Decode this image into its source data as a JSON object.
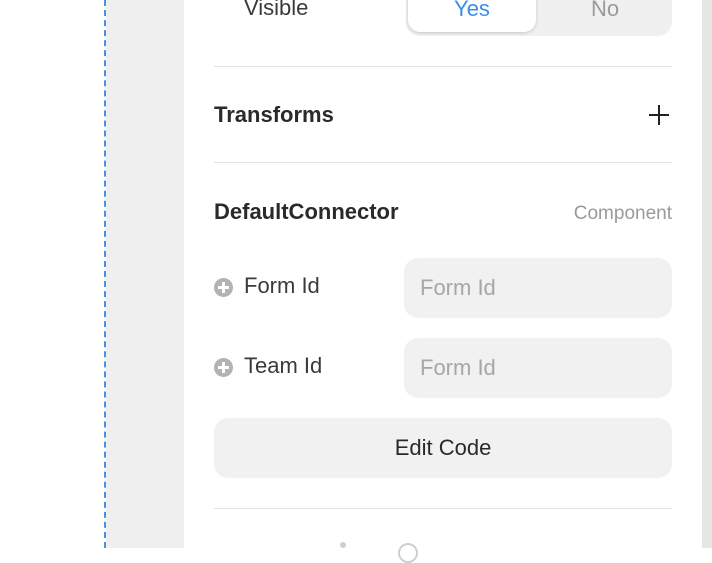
{
  "visible_row": {
    "label": "Visible",
    "options": [
      "Yes",
      "No"
    ],
    "selected": "Yes",
    "accent": "#3b8ee8"
  },
  "transforms": {
    "title": "Transforms",
    "add_icon": "plus-icon"
  },
  "component": {
    "title": "DefaultConnector",
    "tag": "Component",
    "fields": [
      {
        "label": "Form Id",
        "placeholder": "Form Id",
        "value": "",
        "icon": "add-circle-icon"
      },
      {
        "label": "Team Id",
        "placeholder": "Form Id",
        "value": "",
        "icon": "add-circle-icon"
      }
    ],
    "edit_code_label": "Edit Code"
  }
}
